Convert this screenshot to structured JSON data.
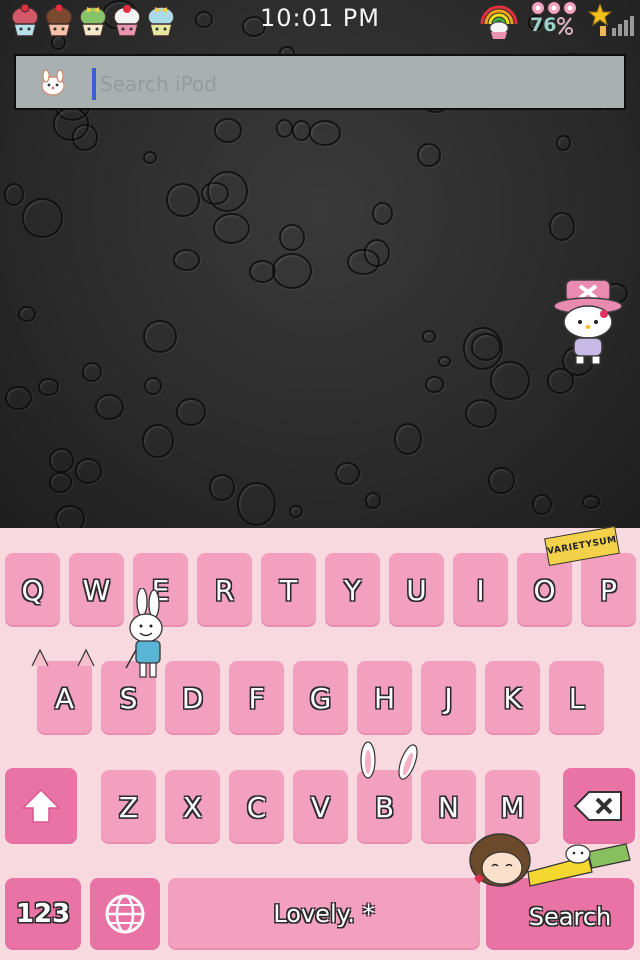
{
  "status_bar": {
    "time": "10:01 PM",
    "battery_percent": "76"
  },
  "search": {
    "placeholder": "Search iPod"
  },
  "keyboard": {
    "row1": [
      "Q",
      "W",
      "E",
      "R",
      "T",
      "Y",
      "U",
      "I",
      "O",
      "P"
    ],
    "row2": [
      "A",
      "S",
      "D",
      "F",
      "G",
      "H",
      "J",
      "K",
      "L"
    ],
    "row3": [
      "Z",
      "X",
      "C",
      "V",
      "B",
      "N",
      "M"
    ],
    "numbers_key": "123",
    "space_key": "Lovely. *",
    "search_key": "Search",
    "sticker_text": "VARIETYSUM"
  },
  "colors": {
    "keyboard_bg": "#f8d9df",
    "key": "#f2a0be",
    "key_dark": "#ea73a6",
    "search_bar": "#a9b0b2"
  }
}
